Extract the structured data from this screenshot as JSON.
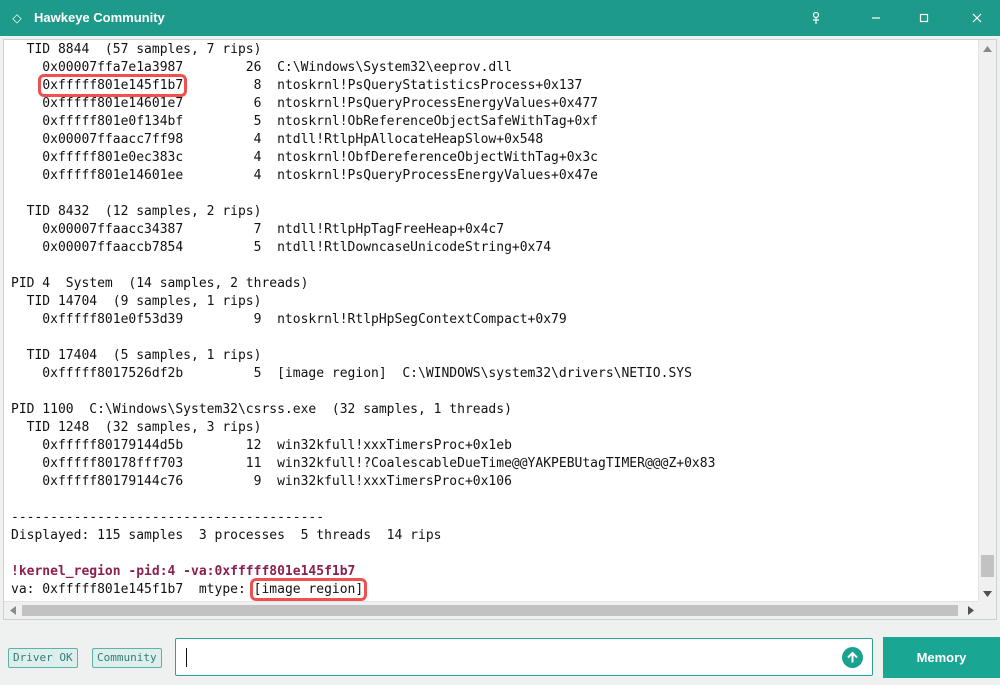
{
  "window": {
    "title": "Hawkeye Community",
    "colors": {
      "titlebar": "#1e9a8b",
      "accent": "#19a693",
      "highlight": "#ef5050",
      "command": "#8a2050"
    }
  },
  "console": {
    "lines": [
      "  TID 8844  (57 samples, 7 rips)",
      "    0x00007ffa7e1a3987        26  C:\\Windows\\System32\\eeprov.dll",
      "    0xfffff801e145f1b7         8  ntoskrnl!PsQueryStatisticsProcess+0x137",
      "    0xfffff801e14601e7         6  ntoskrnl!PsQueryProcessEnergyValues+0x477",
      "    0xfffff801e0f134bf         5  ntoskrnl!ObReferenceObjectSafeWithTag+0xf",
      "    0x00007ffaacc7ff98         4  ntdll!RtlpHpAllocateHeapSlow+0x548",
      "    0xfffff801e0ec383c         4  ntoskrnl!ObfDereferenceObjectWithTag+0x3c",
      "    0xfffff801e14601ee         4  ntoskrnl!PsQueryProcessEnergyValues+0x47e",
      "",
      "  TID 8432  (12 samples, 2 rips)",
      "    0x00007ffaacc34387         7  ntdll!RtlpHpTagFreeHeap+0x4c7",
      "    0x00007ffaaccb7854         5  ntdll!RtlDowncaseUnicodeString+0x74",
      "",
      "PID 4  System  (14 samples, 2 threads)",
      "  TID 14704  (9 samples, 1 rips)",
      "    0xfffff801e0f53d39         9  ntoskrnl!RtlpHpSegContextCompact+0x79",
      "",
      "  TID 17404  (5 samples, 1 rips)",
      "    0xfffff8017526df2b         5  [image region]  C:\\WINDOWS\\system32\\drivers\\NETIO.SYS",
      "",
      "PID 1100  C:\\Windows\\System32\\csrss.exe  (32 samples, 1 threads)",
      "  TID 1248  (32 samples, 3 rips)",
      "    0xfffff80179144d5b        12  win32kfull!xxxTimersProc+0x1eb",
      "    0xfffff80178fff703        11  win32kfull!?CoalescableDueTime@@YAKPEBUtagTIMER@@@Z+0x83",
      "    0xfffff80179144c76         9  win32kfull!xxxTimersProc+0x106",
      "",
      "----------------------------------------",
      "Displayed: 115 samples  3 processes  5 threads  14 rips",
      ""
    ],
    "highlighted_addr": {
      "prefix": "    ",
      "addr": "0xfffff801e145f1b7",
      "rest": "         8  ntoskrnl!PsQueryStatisticsProcess+0x137"
    },
    "command": "!kernel_region -pid:4 -va:0xfffff801e145f1b7",
    "result": {
      "prefix": "va: 0xfffff801e145f1b7  mtype: ",
      "mtype": "[image region]"
    }
  },
  "bottom": {
    "chips": [
      "Driver OK",
      "Community"
    ],
    "input_value": "",
    "send_icon": "arrow-up-circle-icon",
    "memory_label": "Memory"
  }
}
